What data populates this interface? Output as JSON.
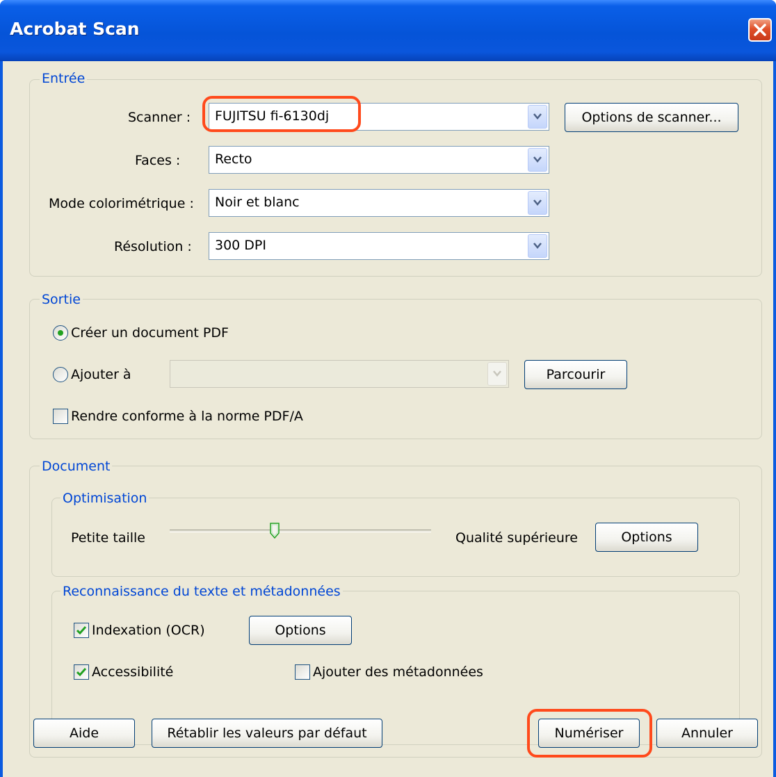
{
  "window": {
    "title": "Acrobat Scan"
  },
  "entree": {
    "legend": "Entrée",
    "scanner_label": "Scanner :",
    "scanner_value": "FUJITSU fi-6130dj",
    "scanner_options_button": "Options de scanner...",
    "faces_label": "Faces :",
    "faces_value": "Recto",
    "mode_label": "Mode colorimétrique :",
    "mode_value": "Noir et blanc",
    "resolution_label": "Résolution :",
    "resolution_value": "300 DPI"
  },
  "sortie": {
    "legend": "Sortie",
    "create_pdf_label": "Créer un document PDF",
    "create_pdf_selected": true,
    "append_label": "Ajouter à",
    "append_selected": false,
    "append_value": "",
    "browse_button": "Parcourir",
    "pdfa_label": "Rendre conforme à la norme PDF/A",
    "pdfa_checked": false
  },
  "document": {
    "legend": "Document",
    "optimisation": {
      "legend": "Optimisation",
      "min_label": "Petite taille",
      "max_label": "Qualité supérieure",
      "slider_value": 0.41,
      "options_button": "Options"
    },
    "ocr": {
      "legend": "Reconnaissance du texte et métadonnées",
      "indexation_label": "Indexation (OCR)",
      "indexation_checked": true,
      "options_button": "Options",
      "accessibilite_label": "Accessibilité",
      "accessibilite_checked": true,
      "metadata_label": "Ajouter des métadonnées",
      "metadata_checked": false
    }
  },
  "footer": {
    "help_button": "Aide",
    "reset_button": "Rétablir les valeurs par défaut",
    "scan_button": "Numériser",
    "cancel_button": "Annuler"
  },
  "colors": {
    "titlebar": "#0554d8",
    "dialog_bg": "#ece9d8",
    "group_legend": "#0046d5",
    "highlight": "#ff4a1c",
    "check": "#21a121"
  }
}
